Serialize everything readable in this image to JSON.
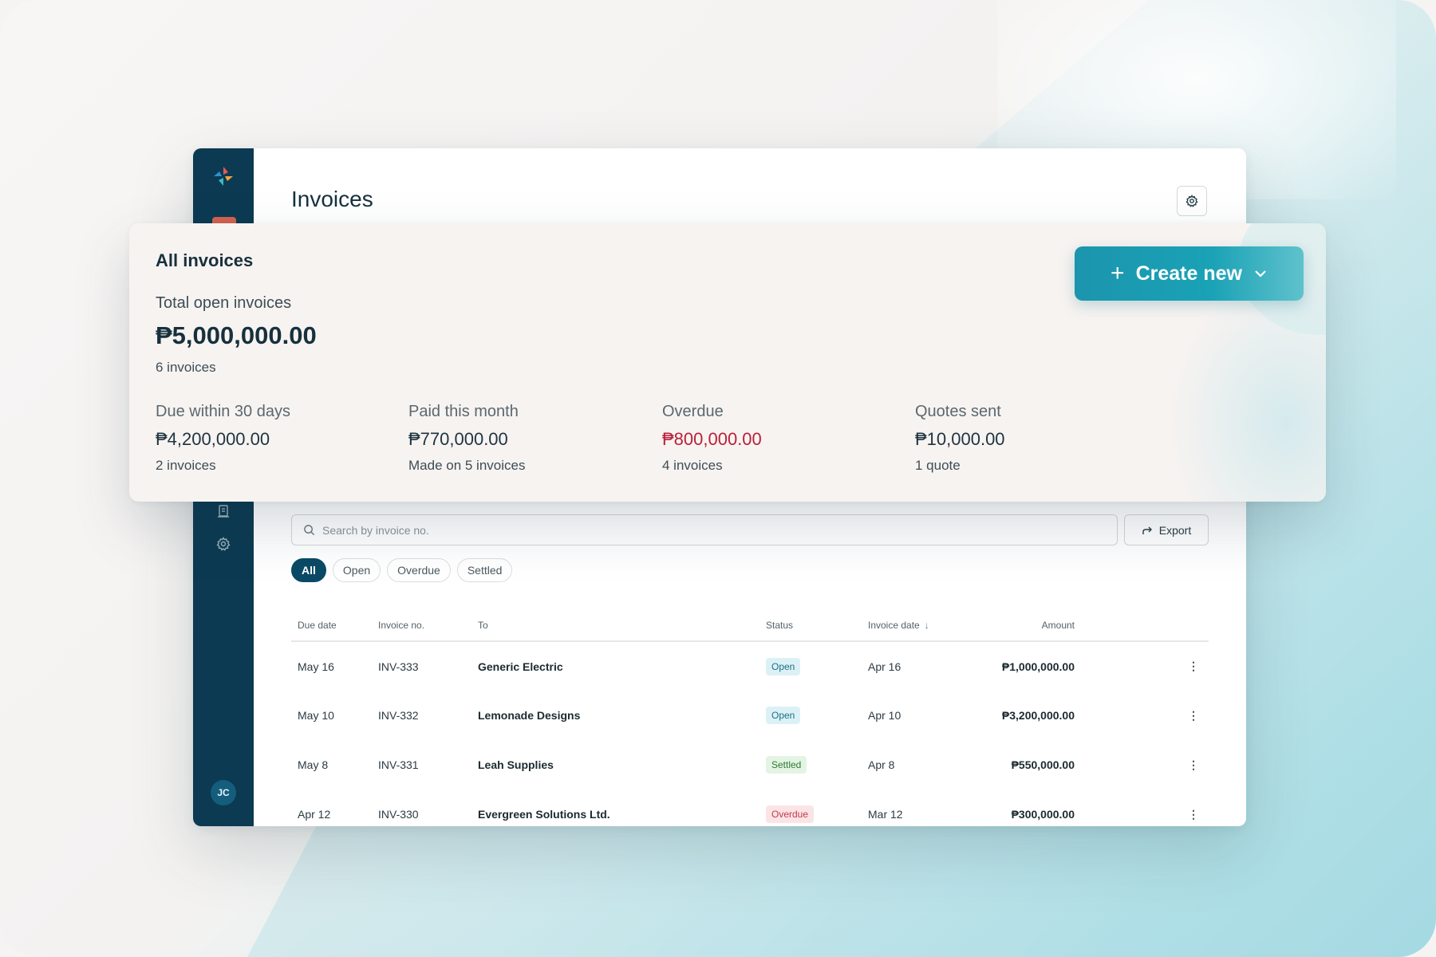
{
  "colors": {
    "sidebar": "#0b3a52",
    "accent": "#1b95ad",
    "overdue": "#b8213a"
  },
  "header": {
    "title": "Invoices",
    "settings_icon": "gear-icon"
  },
  "summary": {
    "title": "All invoices",
    "total_label": "Total open invoices",
    "total_value": "₱5,000,000.00",
    "total_count": "6 invoices",
    "create_button": "Create new",
    "stats": [
      {
        "label": "Due within 30 days",
        "value": "₱4,200,000.00",
        "sub": "2 invoices"
      },
      {
        "label": "Paid this month",
        "value": "₱770,000.00",
        "sub": "Made on 5 invoices"
      },
      {
        "label": "Overdue",
        "value": "₱800,000.00",
        "sub": "4 invoices"
      },
      {
        "label": "Quotes sent",
        "value": "₱10,000.00",
        "sub": "1 quote"
      }
    ]
  },
  "search": {
    "placeholder": "Search by invoice no.",
    "value": ""
  },
  "export_label": "Export",
  "filters": [
    "All",
    "Open",
    "Overdue",
    "Settled"
  ],
  "active_filter": "All",
  "table": {
    "columns": [
      "Due date",
      "Invoice no.",
      "To",
      "Status",
      "Invoice date",
      "Amount"
    ],
    "rows": [
      {
        "due": "May 16",
        "no": "INV-333",
        "to": "Generic Electric",
        "status": "Open",
        "invoice_date": "Apr 16",
        "amount": "₱1,000,000.00"
      },
      {
        "due": "May 10",
        "no": "INV-332",
        "to": "Lemonade Designs",
        "status": "Open",
        "invoice_date": "Apr 10",
        "amount": "₱3,200,000.00"
      },
      {
        "due": "May 8",
        "no": "INV-331",
        "to": "Leah Supplies",
        "status": "Settled",
        "invoice_date": "Apr 8",
        "amount": "₱550,000.00"
      },
      {
        "due": "Apr 12",
        "no": "INV-330",
        "to": "Evergreen Solutions Ltd.",
        "status": "Overdue",
        "invoice_date": "Mar 12",
        "amount": "₱300,000.00"
      }
    ]
  },
  "user": {
    "initials": "JC"
  }
}
